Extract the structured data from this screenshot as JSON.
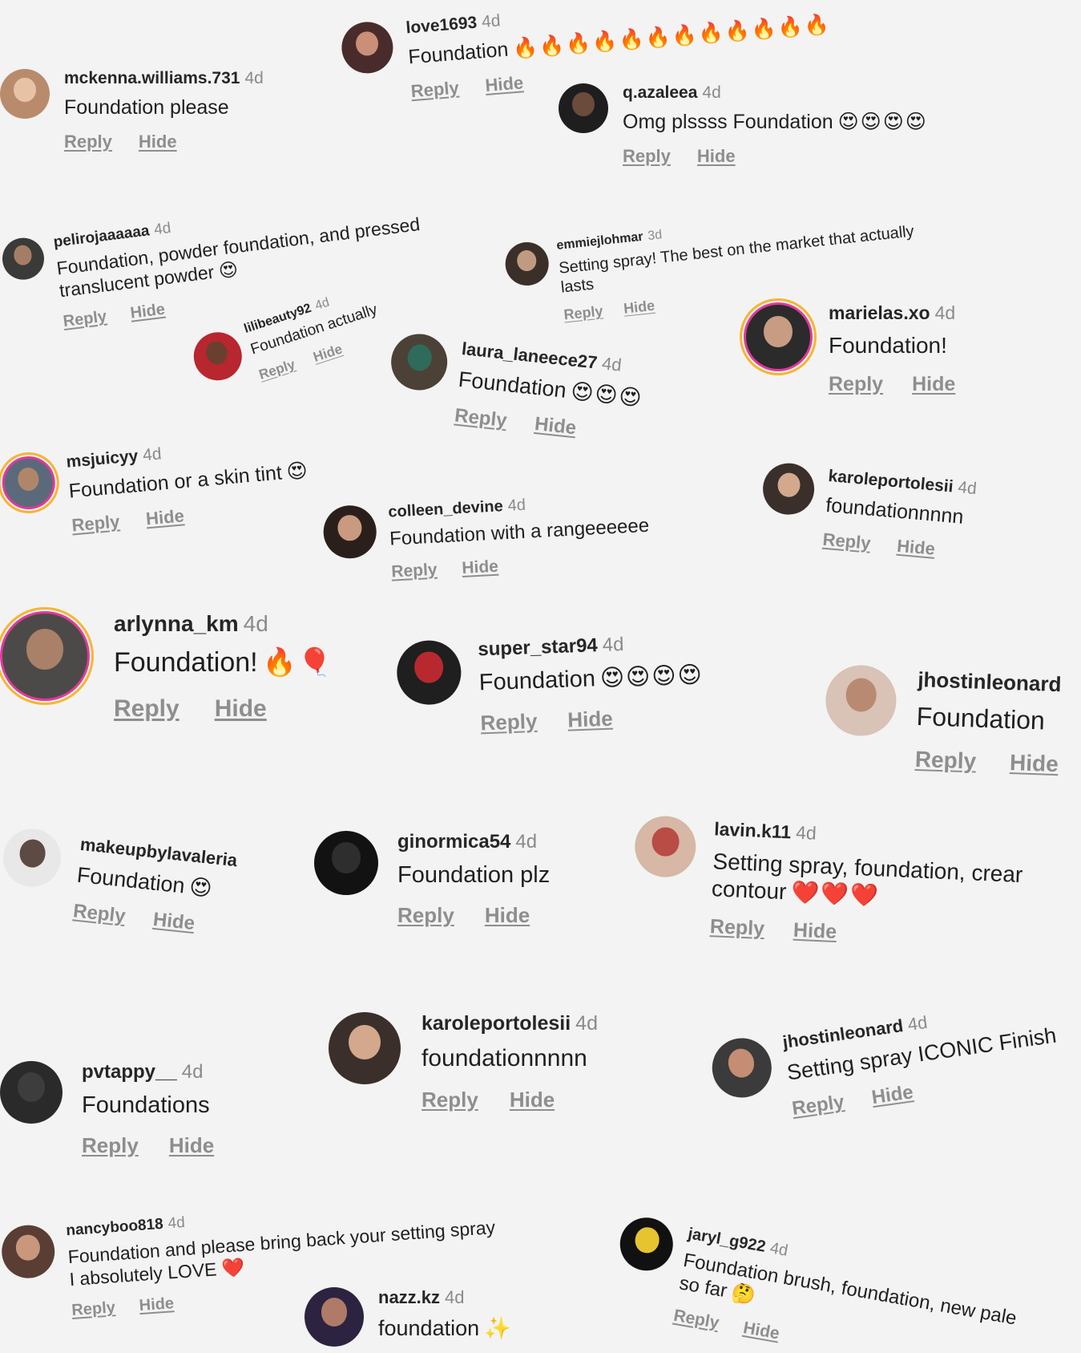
{
  "actions": {
    "reply": "Reply",
    "hide": "Hide"
  },
  "comments": [
    {
      "user": "love1693",
      "time": "4d",
      "text": "Foundation",
      "emoji": "🔥🔥🔥🔥🔥🔥🔥🔥🔥🔥🔥🔥",
      "avatar_color": "#4a2b2b",
      "face_color": "#c98f78"
    },
    {
      "user": "mckenna.williams.731",
      "time": "4d",
      "text": "Foundation please",
      "emoji": "",
      "avatar_color": "#b98b6d",
      "face_color": "#e8c2a4"
    },
    {
      "user": "q.azaleea",
      "time": "4d",
      "text": "Omg plssss Foundation",
      "emoji": "😍😍😍😍",
      "avatar_color": "#1e1e1e",
      "face_color": "#6a4b3c"
    },
    {
      "user": "pelirojaaaaaa",
      "time": "4d",
      "text": "Foundation, powder foundation, and pressed",
      "text2": "translucent powder",
      "emoji": "😍",
      "avatar_color": "#3a3a38",
      "face_color": "#a57d66"
    },
    {
      "user": "emmiejlohmar",
      "time": "3d",
      "text": "Setting spray! The best on the market that actually",
      "text2": "lasts",
      "emoji": "",
      "avatar_color": "#3b2f2a",
      "face_color": "#c19a82"
    },
    {
      "user": "lilibeauty92",
      "time": "4d",
      "text": "Foundation actually",
      "emoji": "",
      "avatar_color": "#b8262f",
      "face_color": "#6b3f2f"
    },
    {
      "user": "marielas.xo",
      "time": "4d",
      "text": "Foundation!",
      "emoji": "",
      "avatar_color": "#2b2b2b",
      "face_color": "#c79c82"
    },
    {
      "user": "laura_laneece27",
      "time": "4d",
      "text": "Foundation",
      "emoji": "😍😍😍",
      "avatar_color": "#4c4136",
      "face_color": "#2f6b5a"
    },
    {
      "user": "msjuicyy",
      "time": "4d",
      "text": "Foundation or a skin tint",
      "emoji": "😍",
      "avatar_color": "#5b6a7a",
      "face_color": "#b0866a"
    },
    {
      "user": "colleen_devine",
      "time": "4d",
      "text": "Foundation with a rangeeeeee",
      "emoji": "",
      "avatar_color": "#2b1f1c",
      "face_color": "#c99a80"
    },
    {
      "user": "karoleportolesii",
      "time": "4d",
      "text": "foundationnnnn",
      "emoji": "",
      "avatar_color": "#3a2f2a",
      "face_color": "#d3a88d"
    },
    {
      "user": "arlynna_km",
      "time": "4d",
      "text": "Foundation!",
      "emoji": "🔥🎈",
      "avatar_color": "#4c4a48",
      "face_color": "#a98068"
    },
    {
      "user": "super_star94",
      "time": "4d",
      "text": "Foundation",
      "emoji": "😍😍😍😍",
      "avatar_color": "#1f1f1f",
      "face_color": "#b8282f"
    },
    {
      "user": "jhostinleonard",
      "time": "",
      "text": "Foundation",
      "emoji": "",
      "avatar_color": "#d9c2b6",
      "face_color": "#b88a72"
    },
    {
      "user": "makeupbylavaleria",
      "time": "",
      "text": "Foundation",
      "emoji": "😍",
      "avatar_color": "#e8e8e8",
      "face_color": "#5d4a42"
    },
    {
      "user": "ginormica54",
      "time": "4d",
      "text": "Foundation plz",
      "emoji": "",
      "avatar_color": "#121212",
      "face_color": "#2e2e2e"
    },
    {
      "user": "lavin.k11",
      "time": "4d",
      "text": "Setting spray, foundation, crear",
      "text2": "contour",
      "emoji": "❤️❤️❤️",
      "avatar_color": "#d7b7a5",
      "face_color": "#b94c45"
    },
    {
      "user": "pvtappy__",
      "time": "4d",
      "text": "Foundations",
      "emoji": "",
      "avatar_color": "#2a2a2a",
      "face_color": "#3d3d3d"
    },
    {
      "user": "karoleportolesii",
      "time": "4d",
      "text": "foundationnnnn",
      "emoji": "",
      "avatar_color": "#3a2f2a",
      "face_color": "#d3a88d"
    },
    {
      "user": "jhostinleonard",
      "time": "4d",
      "text": "Setting spray ICONIC Finish",
      "emoji": "",
      "avatar_color": "#3b3b3b",
      "face_color": "#c48d74"
    },
    {
      "user": "nancyboo818",
      "time": "4d",
      "text": "Foundation and please bring back your setting spray",
      "text2": "I absolutely LOVE",
      "emoji": "❤️",
      "avatar_color": "#5a3e33",
      "face_color": "#c9977c"
    },
    {
      "user": "jaryl_g922",
      "time": "4d",
      "text": "Foundation brush, foundation, new pale",
      "text2": "so far",
      "emoji": "🤔",
      "avatar_color": "#111111",
      "face_color": "#e6c430"
    },
    {
      "user": "nazz.kz",
      "time": "4d",
      "text": "foundation",
      "emoji": "✨",
      "avatar_color": "#2c2340",
      "face_color": "#b07a68"
    }
  ]
}
